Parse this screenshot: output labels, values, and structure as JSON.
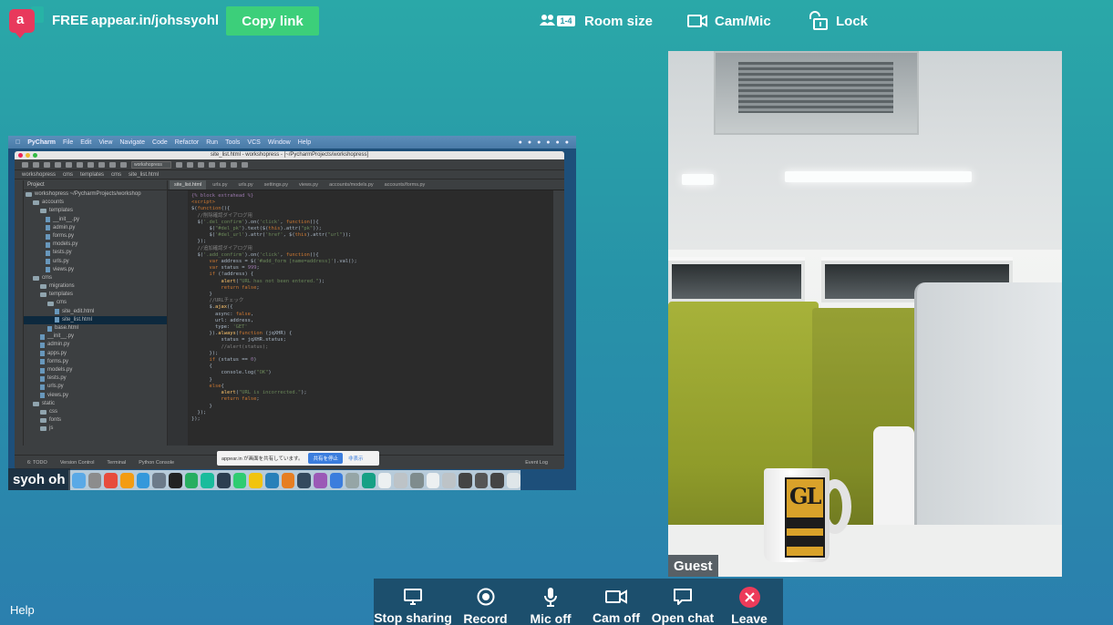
{
  "header": {
    "plan": "FREE",
    "room_url": "appear.in/johssyohl",
    "copy_link_label": "Copy link",
    "room_size_label": "Room size",
    "room_size_badge": "1-4",
    "cam_mic_label": "Cam/Mic",
    "lock_label": "Lock"
  },
  "participants": {
    "screen_share_name": "syoh oh",
    "guest_name": "Guest"
  },
  "shared_screen": {
    "app_name": "PyCharm",
    "menu": [
      "File",
      "Edit",
      "View",
      "Navigate",
      "Code",
      "Refactor",
      "Run",
      "Tools",
      "VCS",
      "Window",
      "Help"
    ],
    "window_title": "site_list.html - workshopress - [~/PycharmProjects/workshopress]",
    "breadcrumb": [
      "workshopress",
      "cms",
      "templates",
      "cms",
      "site_list.html"
    ],
    "project_header": "Project",
    "tree": [
      "workshopress ~/PycharmProjects/workshop",
      "accounts",
      "templates",
      "__init__.py",
      "admin.py",
      "forms.py",
      "models.py",
      "tests.py",
      "urls.py",
      "views.py",
      "cms",
      "migrations",
      "templates",
      "cms",
      "site_edit.html",
      "site_list.html",
      "base.html",
      "__init__.py",
      "admin.py",
      "apps.py",
      "forms.py",
      "models.py",
      "tests.py",
      "urls.py",
      "views.py",
      "static",
      "css",
      "fonts",
      "js"
    ],
    "tabs": [
      "site_list.html",
      "urls.py",
      "urls.py",
      "settings.py",
      "views.py",
      "accounts/models.py",
      "accounts/forms.py"
    ],
    "status_items": [
      "6: TODO",
      "Version Control",
      "Terminal",
      "Python Console",
      "Event Log"
    ],
    "notification_text": "appear.in が画面を共有しています。",
    "notification_stop": "共有を停止",
    "notification_hide": "非表示"
  },
  "toolbar": {
    "stop_sharing": "Stop sharing",
    "record": "Record",
    "mic_off": "Mic off",
    "cam_off": "Cam off",
    "open_chat": "Open chat",
    "leave": "Leave"
  },
  "footer": {
    "help": "Help"
  },
  "colors": {
    "accent_green": "#3ccf7a",
    "leave_red": "#ec3b5a",
    "logo_pink": "#e8395c",
    "toolbar_bg": "#1c4f6d"
  },
  "icons": [
    "people-icon",
    "camera-icon",
    "lock-icon",
    "monitor-icon",
    "record-icon",
    "microphone-icon",
    "video-camera-icon",
    "chat-icon",
    "close-icon"
  ]
}
